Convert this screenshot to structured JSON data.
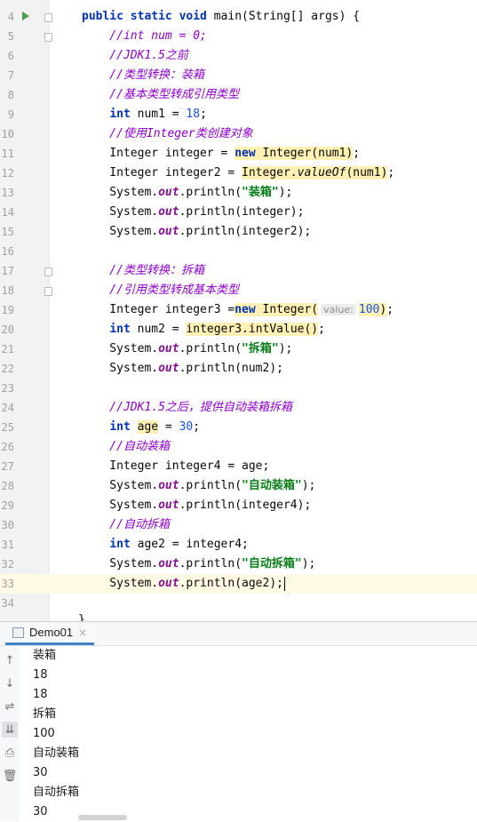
{
  "editor": {
    "current_line": 33,
    "lines": [
      {
        "num": "4",
        "run": true,
        "fold": true,
        "parts": [
          {
            "t": "public static void ",
            "c": "kw"
          },
          {
            "t": "main(String[] args) {",
            "c": ""
          }
        ]
      },
      {
        "num": "5",
        "fold": true,
        "parts": [
          {
            "t": "    //int num = 0;",
            "c": "cm"
          }
        ]
      },
      {
        "num": "6",
        "parts": [
          {
            "t": "    //JDK1.5之前",
            "c": "cm"
          }
        ]
      },
      {
        "num": "7",
        "parts": [
          {
            "t": "    //类型转换：装箱",
            "c": "cm"
          }
        ]
      },
      {
        "num": "8",
        "parts": [
          {
            "t": "    //基本类型转成引用类型",
            "c": "cm"
          }
        ]
      },
      {
        "num": "9",
        "parts": [
          {
            "t": "    ",
            "c": ""
          },
          {
            "t": "int",
            "c": "kw"
          },
          {
            "t": " num1 = ",
            "c": ""
          },
          {
            "t": "18",
            "c": "nm"
          },
          {
            "t": ";",
            "c": ""
          }
        ]
      },
      {
        "num": "10",
        "parts": [
          {
            "t": "    //使用Integer类创建对象",
            "c": "cm"
          }
        ]
      },
      {
        "num": "11",
        "parts": [
          {
            "t": "    Integer integer = ",
            "c": ""
          },
          {
            "t": "new Integer(num1)",
            "c": "hlmix"
          },
          {
            "t": ";",
            "c": ""
          }
        ]
      },
      {
        "num": "12",
        "parts": [
          {
            "t": "    Integer integer2 = ",
            "c": ""
          },
          {
            "t": "Integer.",
            "c": "hl"
          },
          {
            "t": "valueOf",
            "c": "hlsm"
          },
          {
            "t": "(num1)",
            "c": "hl"
          },
          {
            "t": ";",
            "c": ""
          }
        ]
      },
      {
        "num": "13",
        "parts": [
          {
            "t": "    System.",
            "c": ""
          },
          {
            "t": "out",
            "c": "fd"
          },
          {
            "t": ".println(",
            "c": ""
          },
          {
            "t": "\"装箱\"",
            "c": "st"
          },
          {
            "t": ");",
            "c": ""
          }
        ]
      },
      {
        "num": "14",
        "parts": [
          {
            "t": "    System.",
            "c": ""
          },
          {
            "t": "out",
            "c": "fd"
          },
          {
            "t": ".println(integer);",
            "c": ""
          }
        ]
      },
      {
        "num": "15",
        "parts": [
          {
            "t": "    System.",
            "c": ""
          },
          {
            "t": "out",
            "c": "fd"
          },
          {
            "t": ".println(integer2);",
            "c": ""
          }
        ]
      },
      {
        "num": "16",
        "parts": []
      },
      {
        "num": "17",
        "fold": true,
        "parts": [
          {
            "t": "    //类型转换：拆箱",
            "c": "cm"
          }
        ]
      },
      {
        "num": "18",
        "fold": true,
        "parts": [
          {
            "t": "    //引用类型转成基本类型",
            "c": "cm"
          }
        ]
      },
      {
        "num": "19",
        "parts": [
          {
            "t": "    Integer integer3 =",
            "c": ""
          },
          {
            "t": "new",
            "c": "hlkw"
          },
          {
            "t": " Integer(",
            "c": "hl"
          },
          {
            "t": "value:",
            "c": "hint"
          },
          {
            "t": "100",
            "c": "hlnm"
          },
          {
            "t": ")",
            "c": "hl"
          },
          {
            "t": ";",
            "c": ""
          }
        ]
      },
      {
        "num": "20",
        "parts": [
          {
            "t": "    ",
            "c": ""
          },
          {
            "t": "int",
            "c": "kw"
          },
          {
            "t": " num2 = ",
            "c": ""
          },
          {
            "t": "integer3.intValue()",
            "c": "hl"
          },
          {
            "t": ";",
            "c": ""
          }
        ]
      },
      {
        "num": "21",
        "parts": [
          {
            "t": "    System.",
            "c": ""
          },
          {
            "t": "out",
            "c": "fd"
          },
          {
            "t": ".println(",
            "c": ""
          },
          {
            "t": "\"拆箱\"",
            "c": "st"
          },
          {
            "t": ");",
            "c": ""
          }
        ]
      },
      {
        "num": "22",
        "parts": [
          {
            "t": "    System.",
            "c": ""
          },
          {
            "t": "out",
            "c": "fd"
          },
          {
            "t": ".println(num2);",
            "c": ""
          }
        ]
      },
      {
        "num": "23",
        "parts": []
      },
      {
        "num": "24",
        "parts": [
          {
            "t": "    //JDK1.5之后，提供自动装箱拆箱",
            "c": "cm"
          }
        ]
      },
      {
        "num": "25",
        "parts": [
          {
            "t": "    ",
            "c": ""
          },
          {
            "t": "int",
            "c": "kw"
          },
          {
            "t": " ",
            "c": ""
          },
          {
            "t": "age",
            "c": "hl"
          },
          {
            "t": " = ",
            "c": ""
          },
          {
            "t": "30",
            "c": "nm"
          },
          {
            "t": ";",
            "c": ""
          }
        ]
      },
      {
        "num": "26",
        "parts": [
          {
            "t": "    //自动装箱",
            "c": "cm"
          }
        ]
      },
      {
        "num": "27",
        "parts": [
          {
            "t": "    Integer integer4 = age;",
            "c": ""
          }
        ]
      },
      {
        "num": "28",
        "parts": [
          {
            "t": "    System.",
            "c": ""
          },
          {
            "t": "out",
            "c": "fd"
          },
          {
            "t": ".println(",
            "c": ""
          },
          {
            "t": "\"自动装箱\"",
            "c": "st"
          },
          {
            "t": ");",
            "c": ""
          }
        ]
      },
      {
        "num": "29",
        "parts": [
          {
            "t": "    System.",
            "c": ""
          },
          {
            "t": "out",
            "c": "fd"
          },
          {
            "t": ".println(integer4);",
            "c": ""
          }
        ]
      },
      {
        "num": "30",
        "parts": [
          {
            "t": "    //自动拆箱",
            "c": "cm"
          }
        ]
      },
      {
        "num": "31",
        "parts": [
          {
            "t": "    ",
            "c": ""
          },
          {
            "t": "int",
            "c": "kw"
          },
          {
            "t": " age2 = integer4;",
            "c": ""
          }
        ]
      },
      {
        "num": "32",
        "parts": [
          {
            "t": "    System.",
            "c": ""
          },
          {
            "t": "out",
            "c": "fd"
          },
          {
            "t": ".println(",
            "c": ""
          },
          {
            "t": "\"自动拆箱\"",
            "c": "st"
          },
          {
            "t": ");",
            "c": ""
          }
        ]
      },
      {
        "num": "33",
        "caret": true,
        "parts": [
          {
            "t": "    System.",
            "c": ""
          },
          {
            "t": "out",
            "c": "fd"
          },
          {
            "t": ".println(age2);",
            "c": ""
          }
        ]
      },
      {
        "num": "34",
        "parts": []
      }
    ],
    "closing_brace": "}"
  },
  "console": {
    "tab_label": "Demo01",
    "tab_close": "×",
    "tools": [
      {
        "name": "arrow-up-icon",
        "glyph": "↑"
      },
      {
        "name": "arrow-down-icon",
        "glyph": "↓"
      },
      {
        "name": "soft-wrap-icon",
        "glyph": "⇌"
      },
      {
        "name": "scroll-to-end-icon",
        "glyph": "⇊",
        "active": true
      },
      {
        "name": "print-icon",
        "glyph": "⎙"
      },
      {
        "name": "trash-icon",
        "glyph": "🗑"
      }
    ],
    "output": [
      "装箱",
      "18",
      "18",
      "拆箱",
      "100",
      "自动装箱",
      "30",
      "自动拆箱",
      "30"
    ]
  },
  "colors": {
    "keyword": "#0033b3",
    "comment": "#8c00c9",
    "string": "#067d17",
    "number": "#1750eb",
    "field": "#871094",
    "highlight": "#fff0b3",
    "current_line": "#fffae3"
  }
}
